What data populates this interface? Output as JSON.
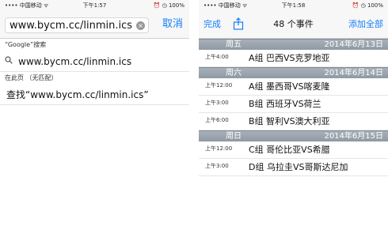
{
  "left_screen": {
    "status": {
      "carrier": "•••• 中国移动 ᯤ",
      "time": "下午1:57",
      "battery": "⏰ ◷ 100%"
    },
    "search": {
      "value": "www.bycm.cc/linmin.ics",
      "clear_icon": "×",
      "cancel_label": "取消"
    },
    "google_section": {
      "header": "“Google”搜索",
      "suggestion": "www.bycm.cc/linmin.ics"
    },
    "on_page_section": {
      "header": "在此页 （无匹配）",
      "find_text": "查找“www.bycm.cc/linmin.ics”"
    }
  },
  "right_screen": {
    "status": {
      "carrier": "•••• 中国移动 ᯤ",
      "time": "下午1:58",
      "battery": "⏰ ◷ 100%"
    },
    "navbar": {
      "done_label": "完成",
      "title": "48 个事件",
      "add_all_label": "添加全部"
    },
    "days": [
      {
        "weekday": "周五",
        "date": "2014年6月13日",
        "events": [
          {
            "time": "上午4:00",
            "title": "A组 巴西VS克罗地亚"
          }
        ]
      },
      {
        "weekday": "周六",
        "date": "2014年6月14日",
        "events": [
          {
            "time": "上午12:00",
            "title": "A组 墨西哥VS喀麦隆"
          },
          {
            "time": "上午3:00",
            "title": "B组 西班牙VS荷兰"
          },
          {
            "time": "上午6:00",
            "title": "B组 智利VS澳大利亚"
          }
        ]
      },
      {
        "weekday": "周日",
        "date": "2014年6月15日",
        "events": [
          {
            "time": "上午12:00",
            "title": "C组 哥伦比亚VS希腊"
          },
          {
            "time": "上午3:00",
            "title": "D组 乌拉圭VS哥斯达尼加"
          }
        ]
      }
    ]
  },
  "colors": {
    "accent": "#147efb",
    "day_header": "#97a1ab"
  }
}
